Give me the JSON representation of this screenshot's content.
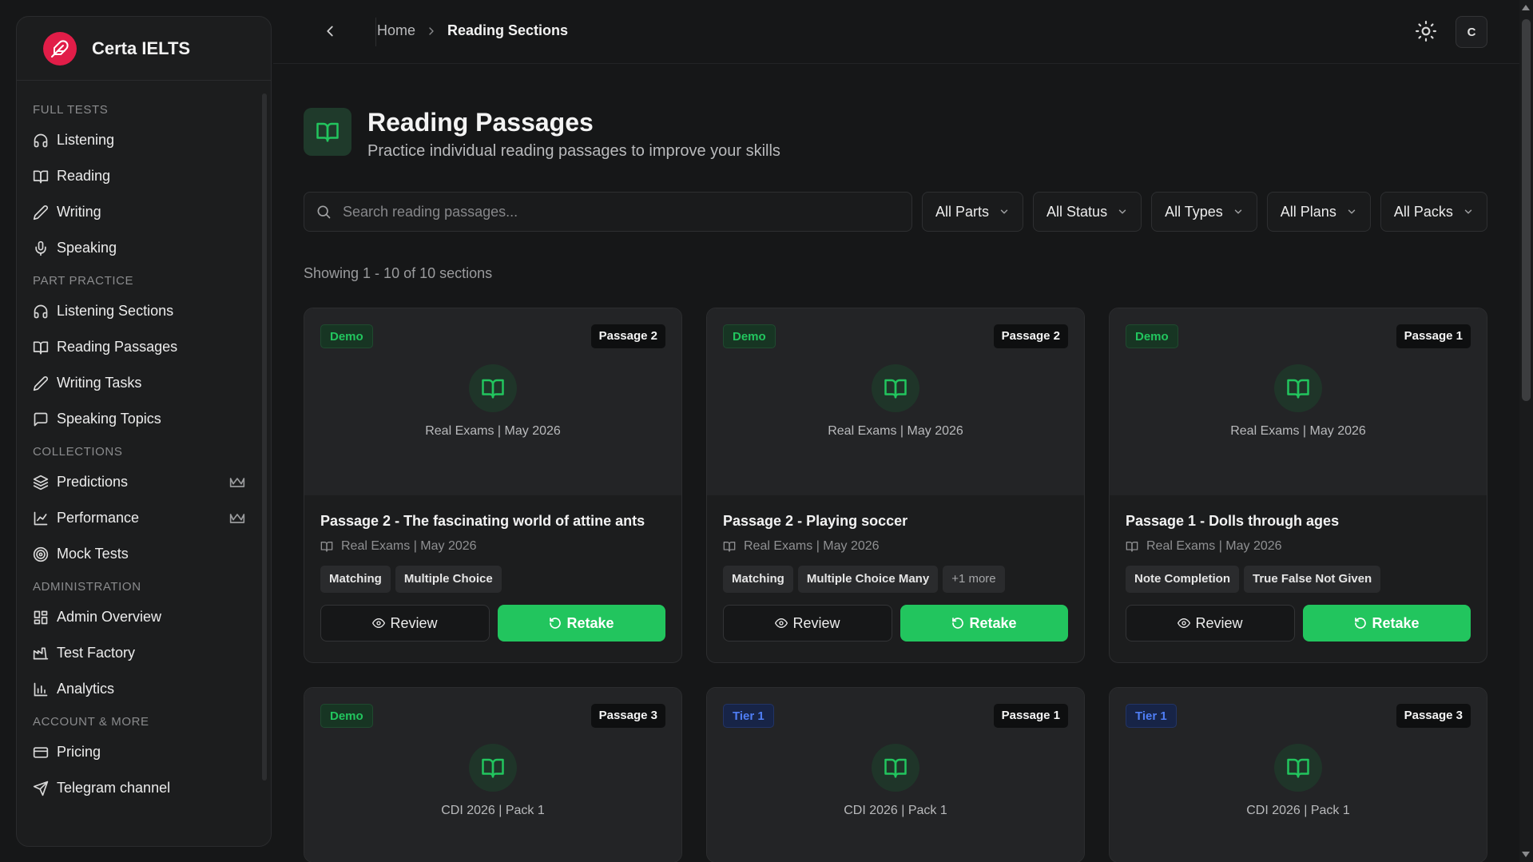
{
  "brand": {
    "name": "Certa IELTS"
  },
  "sidebar": {
    "sections": [
      {
        "title": "FULL TESTS",
        "items": [
          {
            "label": "Listening",
            "icon": "headphones-icon"
          },
          {
            "label": "Reading",
            "icon": "book-icon"
          },
          {
            "label": "Writing",
            "icon": "pencil-icon"
          },
          {
            "label": "Speaking",
            "icon": "microphone-icon"
          }
        ]
      },
      {
        "title": "PART PRACTICE",
        "items": [
          {
            "label": "Listening Sections",
            "icon": "headphones-icon"
          },
          {
            "label": "Reading Passages",
            "icon": "book-icon"
          },
          {
            "label": "Writing Tasks",
            "icon": "pencil-icon"
          },
          {
            "label": "Speaking Topics",
            "icon": "message-icon"
          }
        ]
      },
      {
        "title": "COLLECTIONS",
        "items": [
          {
            "label": "Predictions",
            "icon": "layers-icon",
            "premium": true
          },
          {
            "label": "Performance",
            "icon": "line-chart-icon",
            "premium": true
          },
          {
            "label": "Mock Tests",
            "icon": "target-icon"
          }
        ]
      },
      {
        "title": "ADMINISTRATION",
        "items": [
          {
            "label": "Admin Overview",
            "icon": "dashboard-icon"
          },
          {
            "label": "Test Factory",
            "icon": "factory-icon"
          },
          {
            "label": "Analytics",
            "icon": "bar-chart-icon"
          }
        ]
      },
      {
        "title": "ACCOUNT & MORE",
        "items": [
          {
            "label": "Pricing",
            "icon": "credit-card-icon"
          },
          {
            "label": "Telegram channel",
            "icon": "send-icon"
          }
        ]
      }
    ]
  },
  "topbar": {
    "breadcrumb": {
      "home": "Home",
      "current": "Reading Sections"
    },
    "avatar_initial": "C"
  },
  "page": {
    "title": "Reading Passages",
    "subtitle": "Practice individual reading passages to improve your skills"
  },
  "filters": {
    "search_placeholder": "Search reading passages...",
    "selects": [
      "All Parts",
      "All Status",
      "All Types",
      "All Plans",
      "All Packs"
    ]
  },
  "results": {
    "showing": "Showing 1 - 10 of 10 sections"
  },
  "cards": [
    {
      "tag": "Demo",
      "tag_type": "demo",
      "passage": "Passage 2",
      "source": "Real Exams | May 2026",
      "title": "Passage 2 - The fascinating world of attine ants",
      "meta": "Real Exams | May 2026",
      "chips": [
        "Matching",
        "Multiple Choice"
      ],
      "more": "",
      "review": "Review",
      "retake": "Retake"
    },
    {
      "tag": "Demo",
      "tag_type": "demo",
      "passage": "Passage 2",
      "source": "Real Exams | May 2026",
      "title": "Passage 2 - Playing soccer",
      "meta": "Real Exams | May 2026",
      "chips": [
        "Matching",
        "Multiple Choice Many"
      ],
      "more": "+1 more",
      "review": "Review",
      "retake": "Retake"
    },
    {
      "tag": "Demo",
      "tag_type": "demo",
      "passage": "Passage 1",
      "source": "Real Exams | May 2026",
      "title": "Passage 1 - Dolls through ages",
      "meta": "Real Exams | May 2026",
      "chips": [
        "Note Completion",
        "True False Not Given"
      ],
      "more": "",
      "review": "Review",
      "retake": "Retake"
    },
    {
      "tag": "Demo",
      "tag_type": "demo",
      "passage": "Passage 3",
      "source": "CDI 2026 | Pack 1"
    },
    {
      "tag": "Tier 1",
      "tag_type": "tier",
      "passage": "Passage 1",
      "source": "CDI 2026 | Pack 1"
    },
    {
      "tag": "Tier 1",
      "tag_type": "tier",
      "passage": "Passage 3",
      "source": "CDI 2026 | Pack 1"
    }
  ],
  "colors": {
    "accent": "#22c55e",
    "brand": "#e11d48",
    "tier": "#4f7ef5",
    "background": "#161718"
  }
}
